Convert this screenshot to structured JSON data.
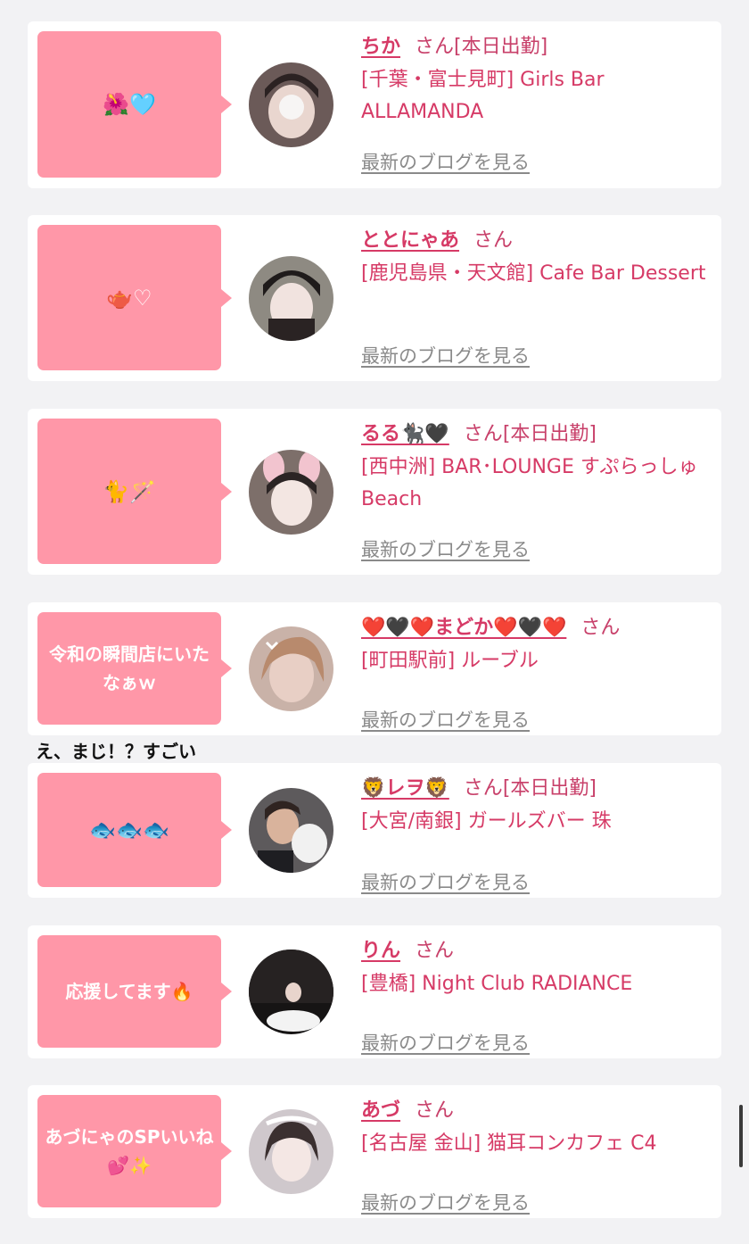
{
  "entries": [
    {
      "bubble": "🌺🩵",
      "name": "ちか",
      "san": "さん",
      "status": "[本日出勤]",
      "shop": "[千葉・富士見町] Girls Bar ALLAMANDA",
      "blog": "最新のブログを見る"
    },
    {
      "bubble": "🫖♡",
      "name": "ととにゃあ",
      "san": "さん",
      "status": "",
      "shop": "[鹿児島県・天文館] Cafe Bar Dessert",
      "blog": "最新のブログを見る"
    },
    {
      "bubble": "🐈🪄",
      "name": "るる🐈‍⬛🖤",
      "san": "さん",
      "status": "[本日出勤]",
      "shop": "[西中洲] BAR･LOUNGE すぷらっしゅBeach",
      "blog": "最新のブログを見る"
    },
    {
      "bubble": "令和の瞬間店にいたなぁｗ",
      "name": "❤️🖤❤️まどか❤️🖤❤️",
      "san": "さん",
      "status": "",
      "shop": "[町田駅前] ルーブル",
      "blog": "最新のブログを見る"
    },
    {
      "bubble": "🐟🐟🐟",
      "name": "🦁レヲ🦁",
      "san": "さん",
      "status": "[本日出勤]",
      "shop": "[大宮/南銀] ガールズバー 珠",
      "blog": "最新のブログを見る"
    },
    {
      "bubble": "応援してます🔥",
      "name": "りん",
      "san": "さん",
      "status": "",
      "shop": "[豊橋] Night Club RADIANCE",
      "blog": "最新のブログを見る"
    },
    {
      "bubble": "あづにゃのSPいいね💕✨",
      "name": "あづ",
      "san": "さん",
      "status": "",
      "shop": "[名古屋 金山] 猫耳コンカフェ C4",
      "blog": "最新のブログを見る"
    }
  ],
  "comment": "え、まじ！？すごい",
  "colors": {
    "bubble": "#ff97a8",
    "name": "#d63a66",
    "card": "#ffffff",
    "background": "#f2f2f4",
    "blog_link": "#8a8a8a"
  }
}
